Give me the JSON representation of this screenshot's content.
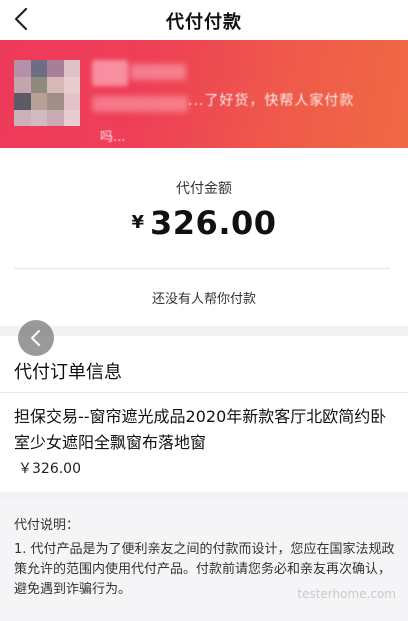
{
  "nav": {
    "title": "代付付款"
  },
  "banner": {
    "text_blurred": "...了好货，快帮人家付款",
    "text_blurred2": "吗...",
    "mosaic_colors": [
      "#b88fa8",
      "#6f6c86",
      "#a77f98",
      "#ddc2c8",
      "#c3a5b0",
      "#8e8a7c",
      "#d7b7b8",
      "#e9ccd0",
      "#5c5a66",
      "#b7a197",
      "#a08e89",
      "#e3c3c8",
      "#cbb2ba",
      "#d0bcc0",
      "#c9aab3",
      "#e7cdd1"
    ]
  },
  "payment": {
    "amount_label": "代付金额",
    "currency": "¥",
    "amount": "326.00",
    "status_text": "还没有人帮你付款"
  },
  "order": {
    "section_title": "代付订单信息",
    "product_title": "担保交易--窗帘遮光成品2020年新款客厅北欧简约卧室少女遮阳全飘窗布落地窗",
    "price": "￥326.00"
  },
  "notes": {
    "title": "代付说明：",
    "body": "1. 代付产品是为了便利亲友之间的付款而设计，您应在国家法规政策允许的范围内使用代付产品。付款前请您务必和亲友再次确认，避免遇到诈骗行为。",
    "watermark": "testerhome.com"
  }
}
